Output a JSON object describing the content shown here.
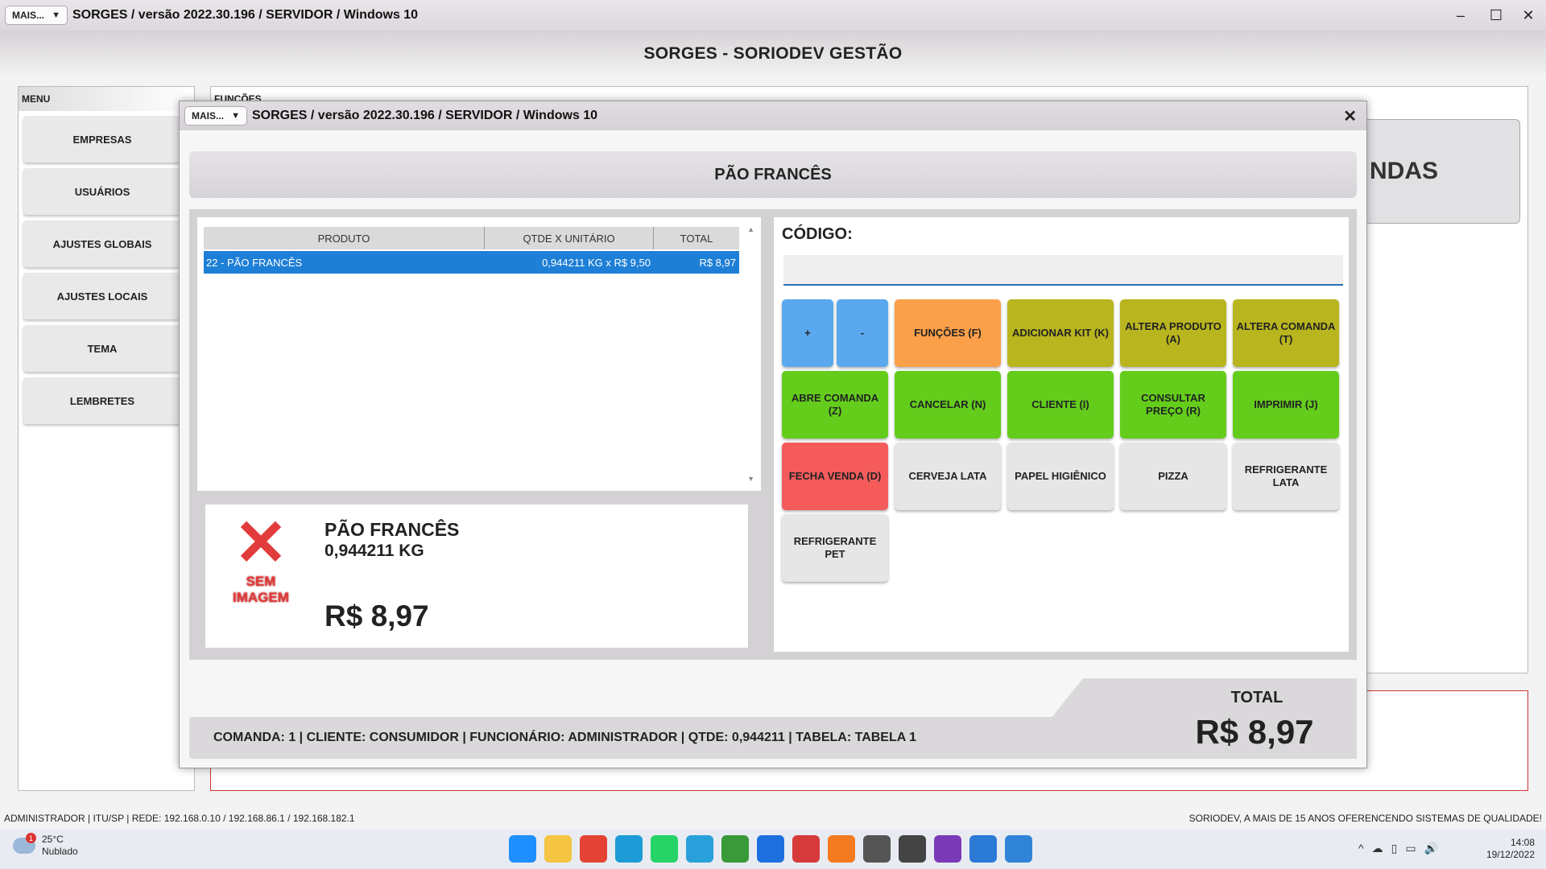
{
  "window": {
    "mais_label": "MAIS...",
    "dropdown_arrow": "▼",
    "title": "SORGES / versão 2022.30.196 / SERVIDOR / Windows 10",
    "minimize_icon": "–",
    "maximize_icon": "☐",
    "close_icon": "✕"
  },
  "app_title": "SORGES - SORIODEV GESTÃO",
  "menu": {
    "header": "MENU",
    "items": [
      {
        "label": "EMPRESAS"
      },
      {
        "label": "USUÁRIOS"
      },
      {
        "label": "AJUSTES GLOBAIS"
      },
      {
        "label": "AJUSTES LOCAIS"
      },
      {
        "label": "TEMA"
      },
      {
        "label": "LEMBRETES"
      }
    ]
  },
  "funcoes": {
    "header": "FUNÇÕES",
    "vendas_label": "NDAS"
  },
  "dialog": {
    "mais_label": "MAIS...",
    "dropdown_arrow": "▼",
    "title": "SORGES / versão 2022.30.196 / SERVIDOR / Windows 10",
    "close_icon": "✕",
    "product_header": "PÃO FRANCÊS",
    "grid": {
      "columns": [
        "PRODUTO",
        "QTDE X UNITÁRIO",
        "TOTAL"
      ],
      "rows": [
        {
          "produto": "22 - PÃO FRANCÊS",
          "qtde": "0,944211 KG x R$ 9,50",
          "total": "R$ 8,97"
        }
      ],
      "scroll_up": "▲",
      "scroll_down": "▼"
    },
    "info": {
      "no_image_symbol": "✕",
      "no_image_label": "SEM IMAGEM",
      "name": "PÃO FRANCÊS",
      "qty": "0,944211  KG",
      "price": "R$ 8,97"
    },
    "code": {
      "label": "CÓDIGO:",
      "value": ""
    },
    "buttons": {
      "plus": "+",
      "minus": "-",
      "funcoes": "FUNÇÕES (F)",
      "adicionar_kit": "ADICIONAR KIT (K)",
      "altera_produto": "ALTERA PRODUTO (A)",
      "altera_comanda": "ALTERA COMANDA (T)",
      "abre_comanda": "ABRE COMANDA (Z)",
      "cancelar": "CANCELAR (N)",
      "cliente": "CLIENTE (I)",
      "consultar_preco": "CONSULTAR PREÇO (R)",
      "imprimir": "IMPRIMIR (J)",
      "fecha_venda": "FECHA VENDA (D)",
      "cerveja_lata": "CERVEJA LATA",
      "papel_higienico": "PAPEL HIGIÊNICO",
      "pizza": "PIZZA",
      "refrigerante_lata": "REFRIGERANTE LATA",
      "refrigerante_pet": "REFRIGERANTE PET"
    },
    "status_line": "COMANDA: 1  |  CLIENTE: CONSUMIDOR  |  FUNCIONÁRIO: ADMINISTRADOR  |  QTDE: 0,944211  |  TABELA: TABELA 1",
    "total_label": "TOTAL",
    "total_value": "R$ 8,97"
  },
  "statusbar": {
    "left": "ADMINISTRADOR |   ITU/SP |   REDE: 192.168.0.10 / 192.168.86.1 / 192.168.182.1",
    "right": "SORIODEV, A MAIS DE 15 ANOS OFERENCENDO SISTEMAS DE QUALIDADE!"
  },
  "taskbar": {
    "weather_temp": "25°C",
    "weather_desc": "Nublado",
    "weather_badge": "1",
    "time": "14:08",
    "date": "19/12/2022",
    "tray_icons": [
      "^",
      "☁",
      "▯",
      "▭",
      "🔊"
    ],
    "app_icons": [
      {
        "name": "windows-start-icon",
        "color": "#1e8fff"
      },
      {
        "name": "file-explorer-icon",
        "color": "#f4c442"
      },
      {
        "name": "chrome-icon",
        "color": "#e44234"
      },
      {
        "name": "edge-icon",
        "color": "#1c9bd6"
      },
      {
        "name": "whatsapp-icon",
        "color": "#25d366"
      },
      {
        "name": "telegram-icon",
        "color": "#2aa0da"
      },
      {
        "name": "spreadsheet-icon",
        "color": "#3a9a3a"
      },
      {
        "name": "messenger-icon",
        "color": "#1d6fe0"
      },
      {
        "name": "app-red-icon",
        "color": "#d63a3a"
      },
      {
        "name": "firefox-icon",
        "color": "#f47a20"
      },
      {
        "name": "sorges-icon",
        "color": "#555555"
      },
      {
        "name": "sorges-active-icon",
        "color": "#444444"
      },
      {
        "name": "clapper-icon",
        "color": "#7a3ab8"
      },
      {
        "name": "mail-icon",
        "color": "#2a7ad6"
      },
      {
        "name": "notepad-icon",
        "color": "#2f84d8"
      }
    ]
  }
}
